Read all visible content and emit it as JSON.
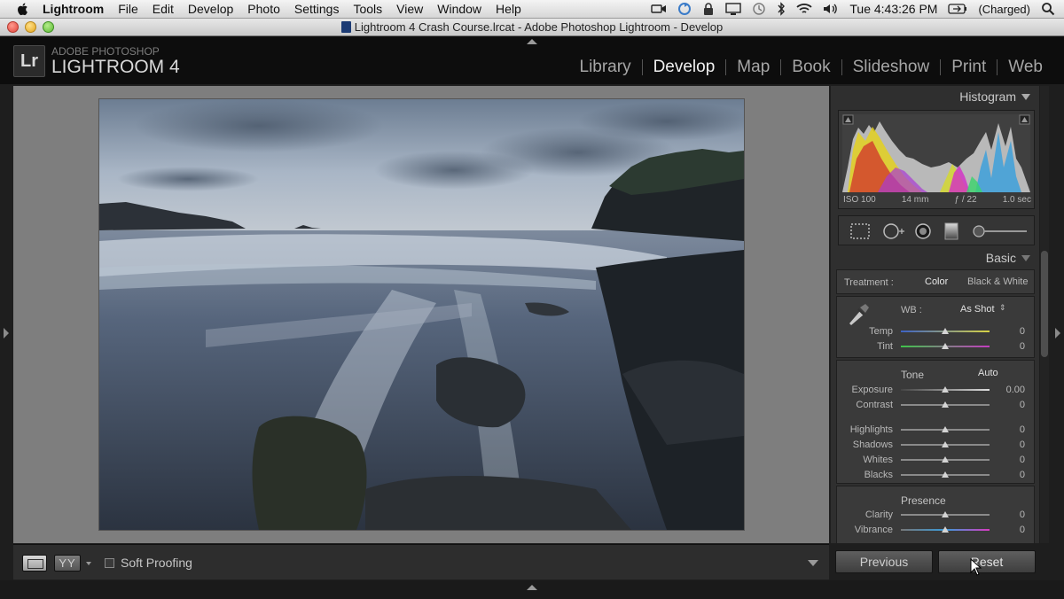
{
  "menubar": {
    "app_name": "Lightroom",
    "items": [
      "File",
      "Edit",
      "Develop",
      "Photo",
      "Settings",
      "Tools",
      "View",
      "Window",
      "Help"
    ],
    "clock": "Tue 4:43:26 PM",
    "battery": "(Charged)",
    "status_icons": [
      "video-icon",
      "sync-icon",
      "lock-icon",
      "display-icon",
      "time-machine-icon",
      "bluetooth-icon",
      "wifi-icon",
      "volume-icon",
      "battery-icon",
      "spotlight-icon"
    ]
  },
  "window": {
    "title": "Lightroom 4 Crash Course.lrcat - Adobe Photoshop Lightroom - Develop"
  },
  "identity": {
    "badge": "Lr",
    "brand_top": "ADOBE PHOTOSHOP",
    "brand_main": "LIGHTROOM 4"
  },
  "modules": {
    "items": [
      "Library",
      "Develop",
      "Map",
      "Book",
      "Slideshow",
      "Print",
      "Web"
    ],
    "active": "Develop"
  },
  "toolbar": {
    "compare_label": "YY",
    "soft_proofing_label": "Soft Proofing",
    "soft_proofing_checked": false
  },
  "histogram": {
    "title": "Histogram",
    "iso": "ISO 100",
    "focal_length": "14 mm",
    "aperture": "ƒ / 22",
    "shutter": "1.0 sec"
  },
  "basic": {
    "title": "Basic",
    "treatment_label": "Treatment :",
    "treatment_options": [
      "Color",
      "Black & White"
    ],
    "wb_label": "WB :",
    "wb_value": "As Shot",
    "temp": {
      "label": "Temp",
      "value": "0"
    },
    "tint": {
      "label": "Tint",
      "value": "0"
    },
    "tone_title": "Tone",
    "auto_label": "Auto",
    "exposure": {
      "label": "Exposure",
      "value": "0.00"
    },
    "contrast": {
      "label": "Contrast",
      "value": "0"
    },
    "highlights": {
      "label": "Highlights",
      "value": "0"
    },
    "shadows": {
      "label": "Shadows",
      "value": "0"
    },
    "whites": {
      "label": "Whites",
      "value": "0"
    },
    "blacks": {
      "label": "Blacks",
      "value": "0"
    },
    "presence_title": "Presence",
    "clarity": {
      "label": "Clarity",
      "value": "0"
    },
    "vibrance": {
      "label": "Vibrance",
      "value": "0"
    }
  },
  "buttons": {
    "previous": "Previous",
    "reset": "Reset"
  },
  "colors": {
    "panel_bg": "#2f2f2f",
    "work_area": "#7e7e7e",
    "active_module": "#f0f0f0",
    "inactive_module": "#a6a6a6"
  }
}
